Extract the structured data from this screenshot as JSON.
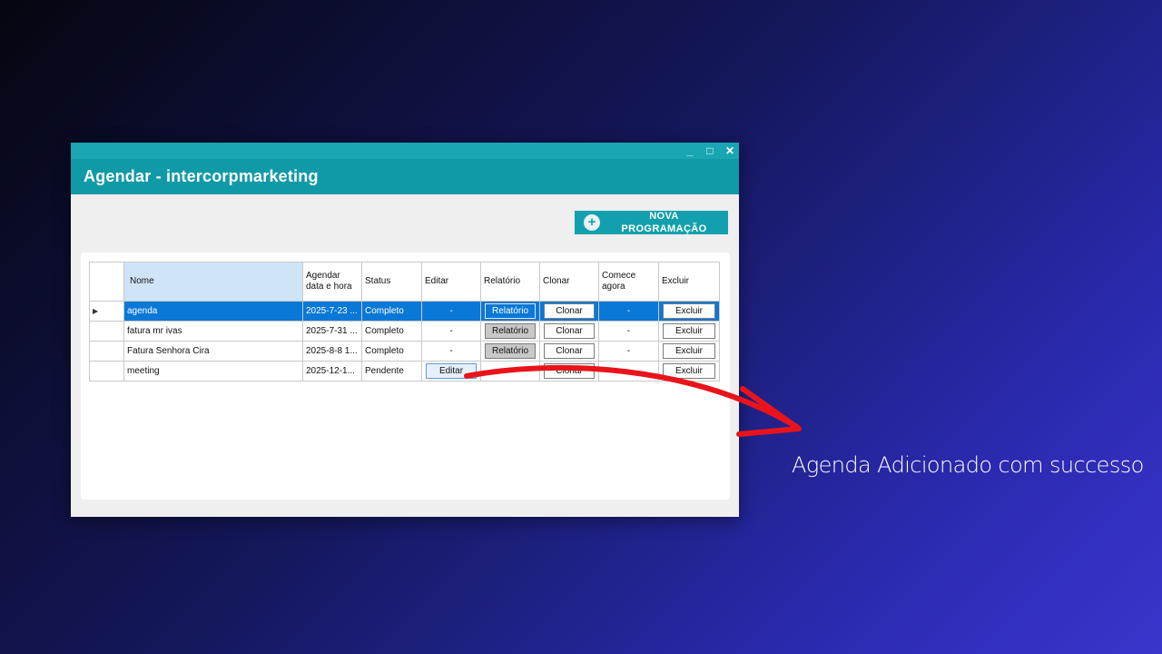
{
  "window": {
    "controls": {
      "minimize": "_",
      "maximize": "□",
      "close": "✕"
    },
    "title": "Agendar - intercorpmarketing",
    "nova_button": {
      "icon": "plus-circle-icon",
      "label_line1": "NOVA",
      "label_line2": "PROGRAMAÇÃO"
    }
  },
  "grid": {
    "columns": {
      "nome": "Nome",
      "agendar_line1": "Agendar",
      "agendar_line2": "data e hora",
      "status": "Status",
      "editar": "Editar",
      "relatorio": "Relatório",
      "clonar": "Clonar",
      "comece_line1": "Comece",
      "comece_line2": "agora",
      "excluir": "Excluir"
    },
    "rows": [
      {
        "marker": "▶",
        "nome": "agenda",
        "agendar": "2025-7-23 ...",
        "status": "Completo",
        "editar": "-",
        "relatorio": "Relatório",
        "clonar": "Clonar",
        "comece": "-",
        "excluir": "Excluir"
      },
      {
        "marker": "",
        "nome": "fatura mr ivas",
        "agendar": "2025-7-31 ...",
        "status": "Completo",
        "editar": "-",
        "relatorio": "Relatório",
        "clonar": "Clonar",
        "comece": "-",
        "excluir": "Excluir"
      },
      {
        "marker": "",
        "nome": "Fatura Senhora Cira",
        "agendar": "2025-8-8 1...",
        "status": "Completo",
        "editar": "-",
        "relatorio": "Relatório",
        "clonar": "Clonar",
        "comece": "-",
        "excluir": "Excluir"
      },
      {
        "marker": "",
        "nome": "meeting",
        "agendar": "2025-12-1...",
        "status": "Pendente",
        "editar": "Editar",
        "relatorio": "",
        "clonar": "Clonar",
        "comece": "",
        "excluir": "Excluir"
      }
    ]
  },
  "annotation": {
    "caption": "Agenda Adicionado com successo",
    "arrow_color": "#e8141a"
  }
}
